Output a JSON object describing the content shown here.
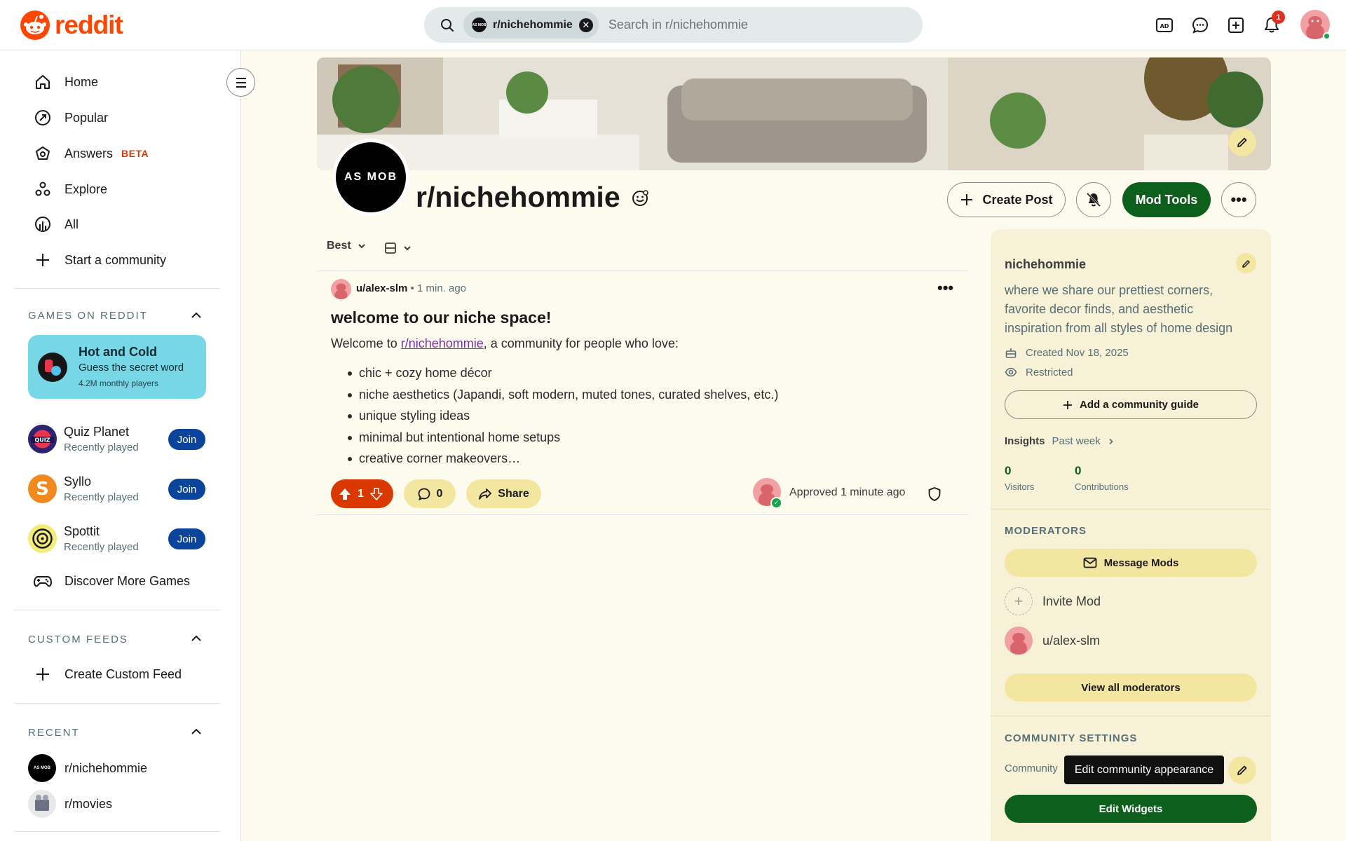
{
  "header": {
    "logo_text": "reddit",
    "search": {
      "chip_label": "r/nichehommie",
      "chip_avatar_text": "AS MOB",
      "placeholder": "Search in r/nichehommie"
    },
    "icons": [
      "advertise-icon",
      "chat-icon",
      "create-post-icon",
      "notifications-icon",
      "user-avatar"
    ],
    "notification_count": "1"
  },
  "sidebar": {
    "nav": [
      {
        "label": "Home",
        "icon": "home-icon"
      },
      {
        "label": "Popular",
        "icon": "popular-icon"
      },
      {
        "label": "Answers",
        "icon": "answers-icon",
        "badge": "BETA"
      },
      {
        "label": "Explore",
        "icon": "explore-icon"
      },
      {
        "label": "All",
        "icon": "all-icon"
      },
      {
        "label": "Start a community",
        "icon": "plus-icon"
      }
    ],
    "games": {
      "title": "GAMES ON REDDIT",
      "featured": {
        "title": "Hot and Cold",
        "subtitle": "Guess the secret word",
        "players": "4.2M monthly players"
      },
      "items": [
        {
          "name": "Quiz Planet",
          "status": "Recently played",
          "action": "Join"
        },
        {
          "name": "Syllo",
          "status": "Recently played",
          "action": "Join"
        },
        {
          "name": "Spottit",
          "status": "Recently played",
          "action": "Join"
        }
      ],
      "discover": "Discover More Games"
    },
    "custom_feeds": {
      "title": "CUSTOM FEEDS",
      "create": "Create Custom Feed"
    },
    "recent": {
      "title": "RECENT",
      "items": [
        "r/nichehommie",
        "r/movies"
      ]
    }
  },
  "community": {
    "avatar_text": "AS MOB",
    "name": "r/nichehommie",
    "create_post": "Create Post",
    "mod_tools": "Mod Tools",
    "more": "•••"
  },
  "feed": {
    "sort": "Best",
    "post": {
      "author": "u/alex-slm",
      "separator": "•",
      "time": "1 min. ago",
      "title": "welcome to our niche space!",
      "body_prefix": "Welcome to ",
      "body_link": "r/nichehommie",
      "body_suffix": ", a community for people who love:",
      "bullets": [
        "chic + cozy home décor",
        "niche aesthetics (Japandi, soft modern, muted tones, curated shelves, etc.)",
        "unique styling ideas",
        "minimal but intentional home setups",
        "creative corner makeovers…"
      ],
      "votes": "1",
      "comments": "0",
      "share": "Share",
      "approved": "Approved 1 minute ago",
      "more": "•••"
    }
  },
  "about": {
    "name": "nichehommie",
    "description": "where we share our prettiest corners, favorite decor finds, and aesthetic inspiration from all styles of home design",
    "created": "Created Nov 18, 2025",
    "visibility": "Restricted",
    "guide_button": "Add a community guide",
    "insights_label": "Insights",
    "insights_range": "Past week",
    "stats": [
      {
        "value": "0",
        "label": "Visitors"
      },
      {
        "value": "0",
        "label": "Contributions"
      }
    ],
    "moderators_title": "MODERATORS",
    "message_mods": "Message Mods",
    "invite_mod": "Invite Mod",
    "moderator": "u/alex-slm",
    "view_all": "View all moderators",
    "settings_title": "COMMUNITY SETTINGS",
    "settings_row": "Community",
    "tooltip": "Edit community appearance",
    "edit_widgets": "Edit Widgets"
  },
  "colors": {
    "brand": "#ff4500",
    "primary_green": "#0d5f1c",
    "pill_yellow": "#f3e6a1",
    "background": "#fdfbee",
    "upvote": "#d93900"
  }
}
